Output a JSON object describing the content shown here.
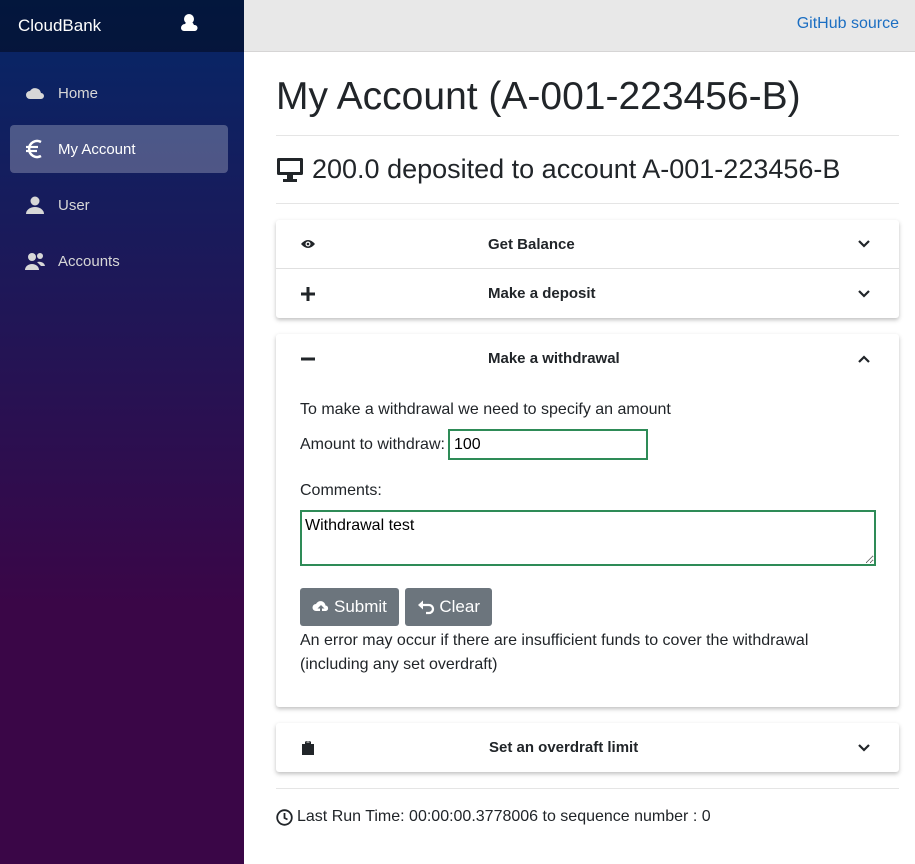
{
  "sidebar": {
    "brand": "CloudBank",
    "brand_icon": "cloud-sun-icon",
    "items": [
      {
        "label": "Home",
        "icon": "cloud-icon"
      },
      {
        "label": "My Account",
        "icon": "euro-icon"
      },
      {
        "label": "User",
        "icon": "user-icon"
      },
      {
        "label": "Accounts",
        "icon": "users-icon"
      }
    ]
  },
  "header": {
    "github_link": "GitHub source"
  },
  "main": {
    "title": "My Account (A-001-223456-B)",
    "status": "200.0 deposited to account A-001-223456-B",
    "panels": {
      "balance": {
        "title": "Get Balance",
        "icon": "eye-icon"
      },
      "deposit": {
        "title": "Make a deposit",
        "icon": "plus-icon"
      },
      "withdrawal": {
        "title": "Make a withdrawal",
        "icon": "minus-icon",
        "intro": "To make a withdrawal we need to specify an amount",
        "amount_label": "Amount to withdraw:",
        "amount_value": "100",
        "comments_label": "Comments:",
        "comments_value": "Withdrawal test",
        "submit_label": "Submit",
        "clear_label": "Clear",
        "note": "An error may occur if there are insufficient funds to cover the withdrawal (including any set overdraft)"
      },
      "overdraft": {
        "title": "Set an overdraft limit",
        "icon": "clipboard-icon"
      }
    },
    "footer": "Last Run Time: 00:00:00.3778006 to sequence number : 0"
  },
  "colors": {
    "sidebar_top": "#052767",
    "sidebar_bottom": "#3a0647",
    "link": "#1b6ec2",
    "button": "#6c757d",
    "input_border": "#2e8b57"
  }
}
